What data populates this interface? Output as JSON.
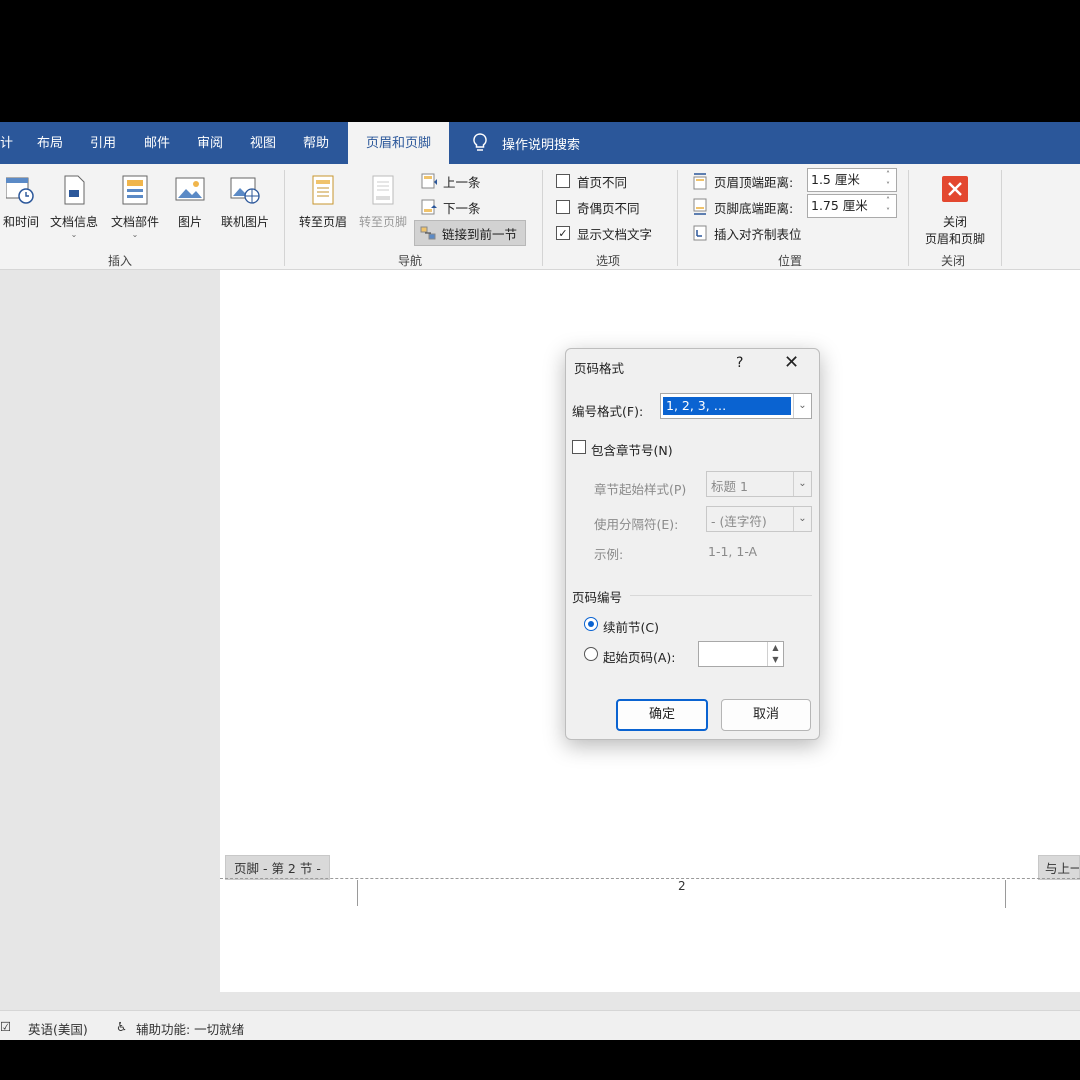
{
  "ribbon_tabs": [
    {
      "label": "计"
    },
    {
      "label": "布局"
    },
    {
      "label": "引用"
    },
    {
      "label": "邮件"
    },
    {
      "label": "审阅"
    },
    {
      "label": "视图"
    },
    {
      "label": "帮助"
    },
    {
      "label": "页眉和页脚"
    }
  ],
  "search": {
    "label": "操作说明搜索"
  },
  "insert_group": {
    "buttons": [
      "和时间",
      "文档信息",
      "文档部件",
      "图片",
      "联机图片"
    ],
    "label": "插入"
  },
  "nav_group": {
    "goto_header": "转至页眉",
    "goto_footer": "转至页脚",
    "previous": "上一条",
    "next": "下一条",
    "link_previous": "链接到前一节",
    "label": "导航"
  },
  "options_group": {
    "different_first": "首页不同",
    "different_odd_even": "奇偶页不同",
    "show_doc_text": "显示文档文字",
    "label": "选项"
  },
  "position_group": {
    "header_top_label": "页眉顶端距离:",
    "header_top_value": "1.5 厘米",
    "footer_bottom_label": "页脚底端距离:",
    "footer_bottom_value": "1.75 厘米",
    "insert_align_tab": "插入对齐制表位",
    "label": "位置"
  },
  "close_group": {
    "close_line1": "关闭",
    "close_line2": "页眉和页脚",
    "label": "关闭"
  },
  "document": {
    "footer_tag": "页脚 - 第 2 节 -",
    "link_tag": "与上一",
    "page_number_field": "2"
  },
  "statusbar": {
    "language": "英语(美国)",
    "accessibility": "辅助功能: 一切就绪"
  },
  "dialog": {
    "title": "页码格式",
    "help": "?",
    "close": "✕",
    "number_format_label": "编号格式(F):",
    "number_format_value": "1, 2, 3, …",
    "include_chapter_label": "包含章节号(N)",
    "chapter_style_label": "章节起始样式(P)",
    "chapter_style_value": "标题 1",
    "separator_label": "使用分隔符(E):",
    "separator_value": "-  (连字符)",
    "example_label": "示例:",
    "example_value": "1-1, 1-A",
    "numbering_section_label": "页码编号",
    "continue_label": "续前节(C)",
    "start_at_label": "起始页码(A):",
    "start_at_value": "",
    "ok": "确定",
    "cancel": "取消"
  },
  "colors": {
    "ribbon_blue": "#2b579a",
    "accent": "#0a63d1",
    "close_red": "#e3472f"
  }
}
